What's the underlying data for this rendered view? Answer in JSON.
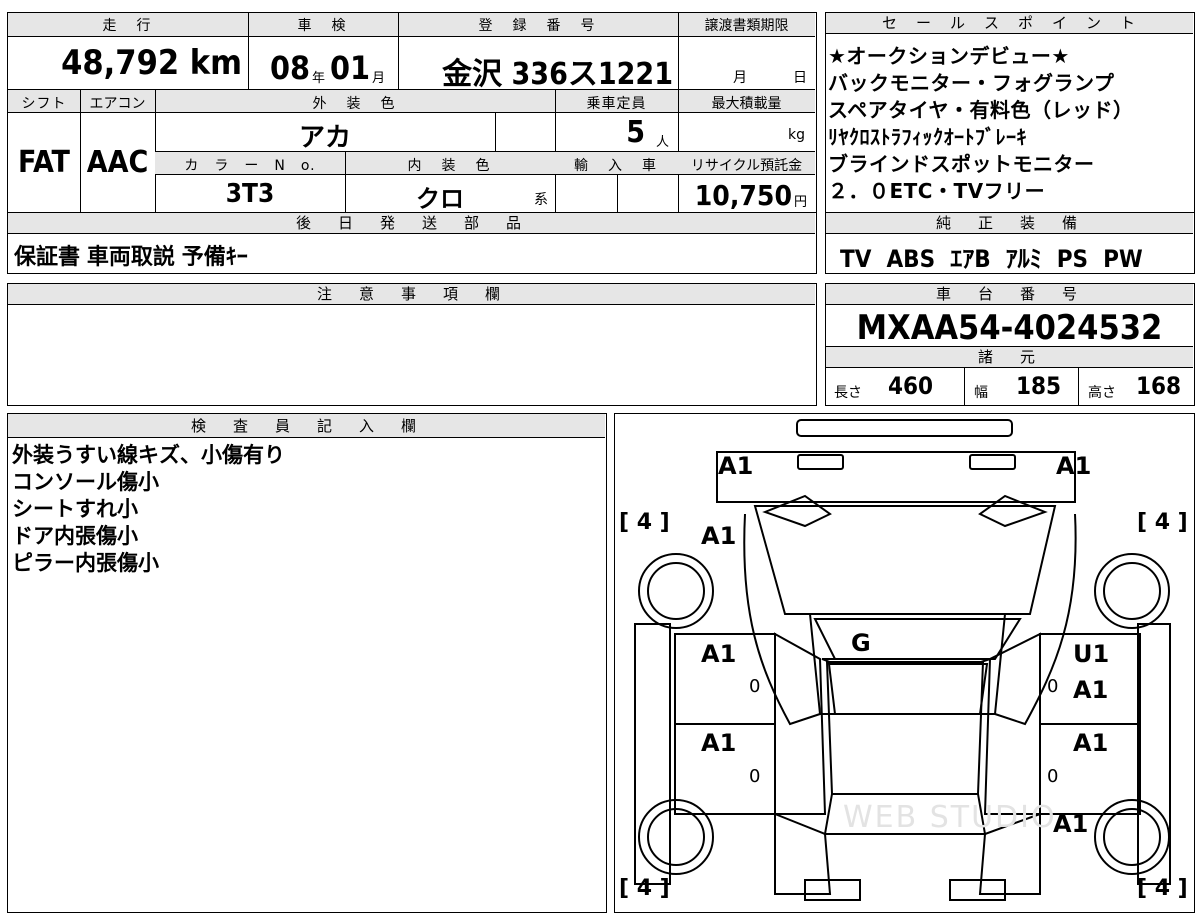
{
  "left_table": {
    "headers": {
      "mileage": "走　行",
      "inspection": "車　検",
      "registration": "登　録　番　号",
      "transfer_deadline": "譲渡書類期限",
      "shift": "シフト",
      "aircon": "エアコン",
      "exterior_color": "外　装　色",
      "capacity": "乗車定員",
      "max_load": "最大積載量",
      "color_no": "カ　ラ　ー　N　o.",
      "interior_color": "内　装　色",
      "import": "輸　入　車",
      "recycle_fee": "リサイクル預託金"
    },
    "mileage_value": "48,792 km",
    "inspection_year": "08",
    "inspection_year_unit": "年",
    "inspection_month": "01",
    "inspection_month_unit": "月",
    "registration_value": "金沢 336ス1221",
    "transfer_month_unit": "月",
    "transfer_day_unit": "日",
    "shift_value": "FAT",
    "aircon_value": "AAC",
    "exterior_color_value": "アカ",
    "capacity_value": "5",
    "capacity_unit": "人",
    "max_load_unit": "kg",
    "color_no_value": "3T3",
    "interior_color_value": "クロ",
    "interior_color_suffix": "系",
    "recycle_value": "10,750",
    "recycle_unit": "円"
  },
  "later_parts": {
    "header": "後　日　発　送　部　品",
    "value": "保証書 車両取説 予備ｷｰ"
  },
  "caution": {
    "header": "注　意　事　項　欄",
    "value": ""
  },
  "inspector": {
    "header": "検　査　員　記　入　欄",
    "lines": [
      "外装うすい線キズ、小傷有り",
      "コンソール傷小",
      "シートすれ小",
      "ドア内張傷小",
      "ピラー内張傷小"
    ]
  },
  "sales_points": {
    "header": "セ　ー　ル　ス　ポ　イ　ン　ト",
    "lines": [
      "★オークションデビュー★",
      "バックモニター・フォグランプ",
      "スペアタイヤ・有料色（レッド）",
      "ﾘﾔｸﾛｽﾄﾗﾌｨｯｸｵｰﾄﾌﾞﾚｰｷ",
      "ブラインドスポットモニター",
      "２．０ETC・TVフリー"
    ]
  },
  "equipment": {
    "header": "純　正　装　備",
    "value": "TV  ABS  ｴｱB  ｱﾙﾐ  PS  PW"
  },
  "chassis": {
    "header": "車　台　番　号",
    "value": "MXAA54-4024532"
  },
  "specs": {
    "header": "諸　元",
    "length_label": "長さ",
    "length_value": "460",
    "width_label": "幅",
    "width_value": "185",
    "height_label": "高さ",
    "height_value": "168"
  },
  "car_diagram": {
    "marks": {
      "front_left_corner": "A1",
      "front_right_corner": "A1",
      "front_left_fender": "A1",
      "windshield": "G",
      "front_left_door": "A1",
      "front_right_door_top": "U1",
      "front_right_door": "A1",
      "rear_left_door": "A1",
      "rear_right_door": "A1",
      "rear_right_fender": "A1"
    },
    "tires": {
      "front_left": "[ 4 ]",
      "front_right": "[ 4 ]",
      "rear_left": "[ 4 ]",
      "rear_right": "[ 4 ]"
    },
    "sill_marks": [
      "0",
      "0",
      "0",
      "0"
    ],
    "watermark": "WEB STUDIO"
  }
}
